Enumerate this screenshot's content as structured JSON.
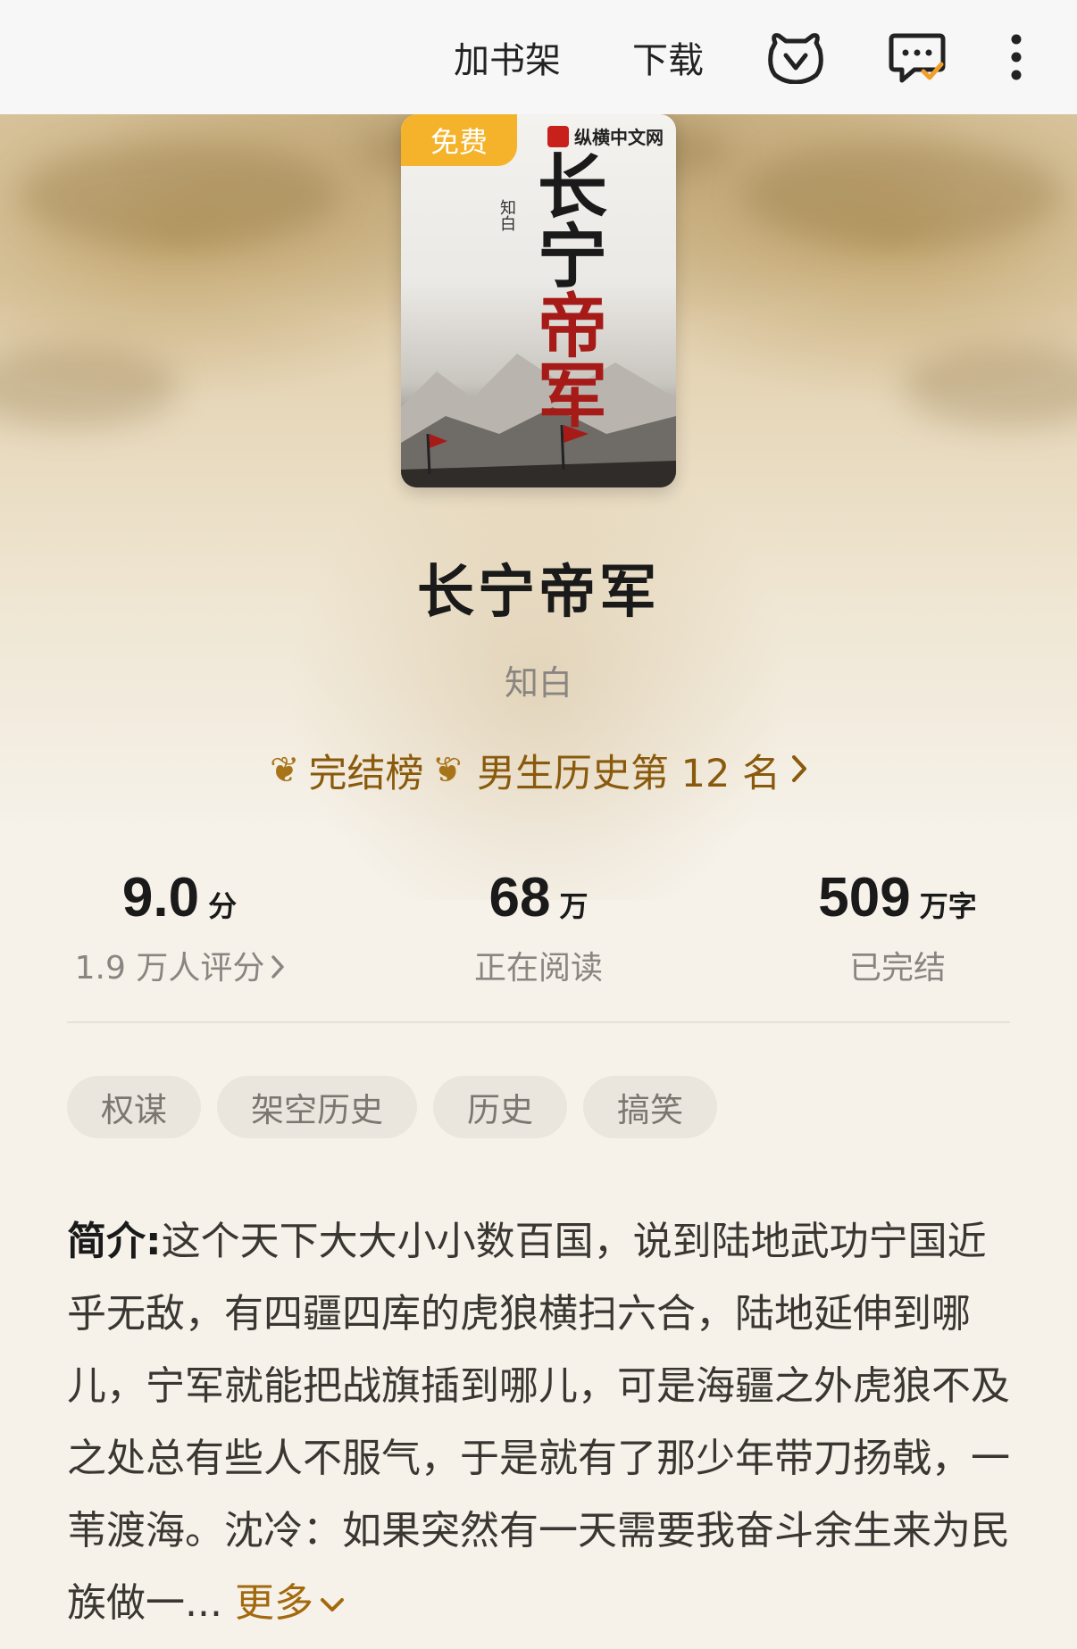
{
  "topbar": {
    "add_shelf": "加书架",
    "download": "下载"
  },
  "cover": {
    "free_tag": "免费",
    "publisher": "纵横中文网",
    "title_line1": "长宁",
    "title_line2": "帝军",
    "author": "知白"
  },
  "book": {
    "title": "长宁帝军",
    "author": "知白"
  },
  "rank": {
    "board": "完结榜",
    "text": "男生历史第 12 名"
  },
  "stats": {
    "score_value": "9.0",
    "score_unit": "分",
    "score_sub": "1.9 万人评分",
    "readers_value": "68",
    "readers_unit": "万",
    "readers_sub": "正在阅读",
    "words_value": "509",
    "words_unit": "万字",
    "words_sub": "已完结"
  },
  "tags": [
    "权谋",
    "架空历史",
    "历史",
    "搞笑"
  ],
  "summary": {
    "label": "简介:",
    "text": "这个天下大大小小数百国，说到陆地武功宁国近乎无敌，有四疆四库的虎狼横扫六合，陆地延伸到哪儿，宁军就能把战旗插到哪儿，可是海疆之外虎狼不及之处总有些人不服气，于是就有了那少年带刀扬戟，一苇渡海。沈冷：如果突然有一天需要我奋斗余生来为民族做一...",
    "more": "更多"
  },
  "colors": {
    "accent_gold": "#a3690e",
    "free_tag": "#f4b32a"
  }
}
